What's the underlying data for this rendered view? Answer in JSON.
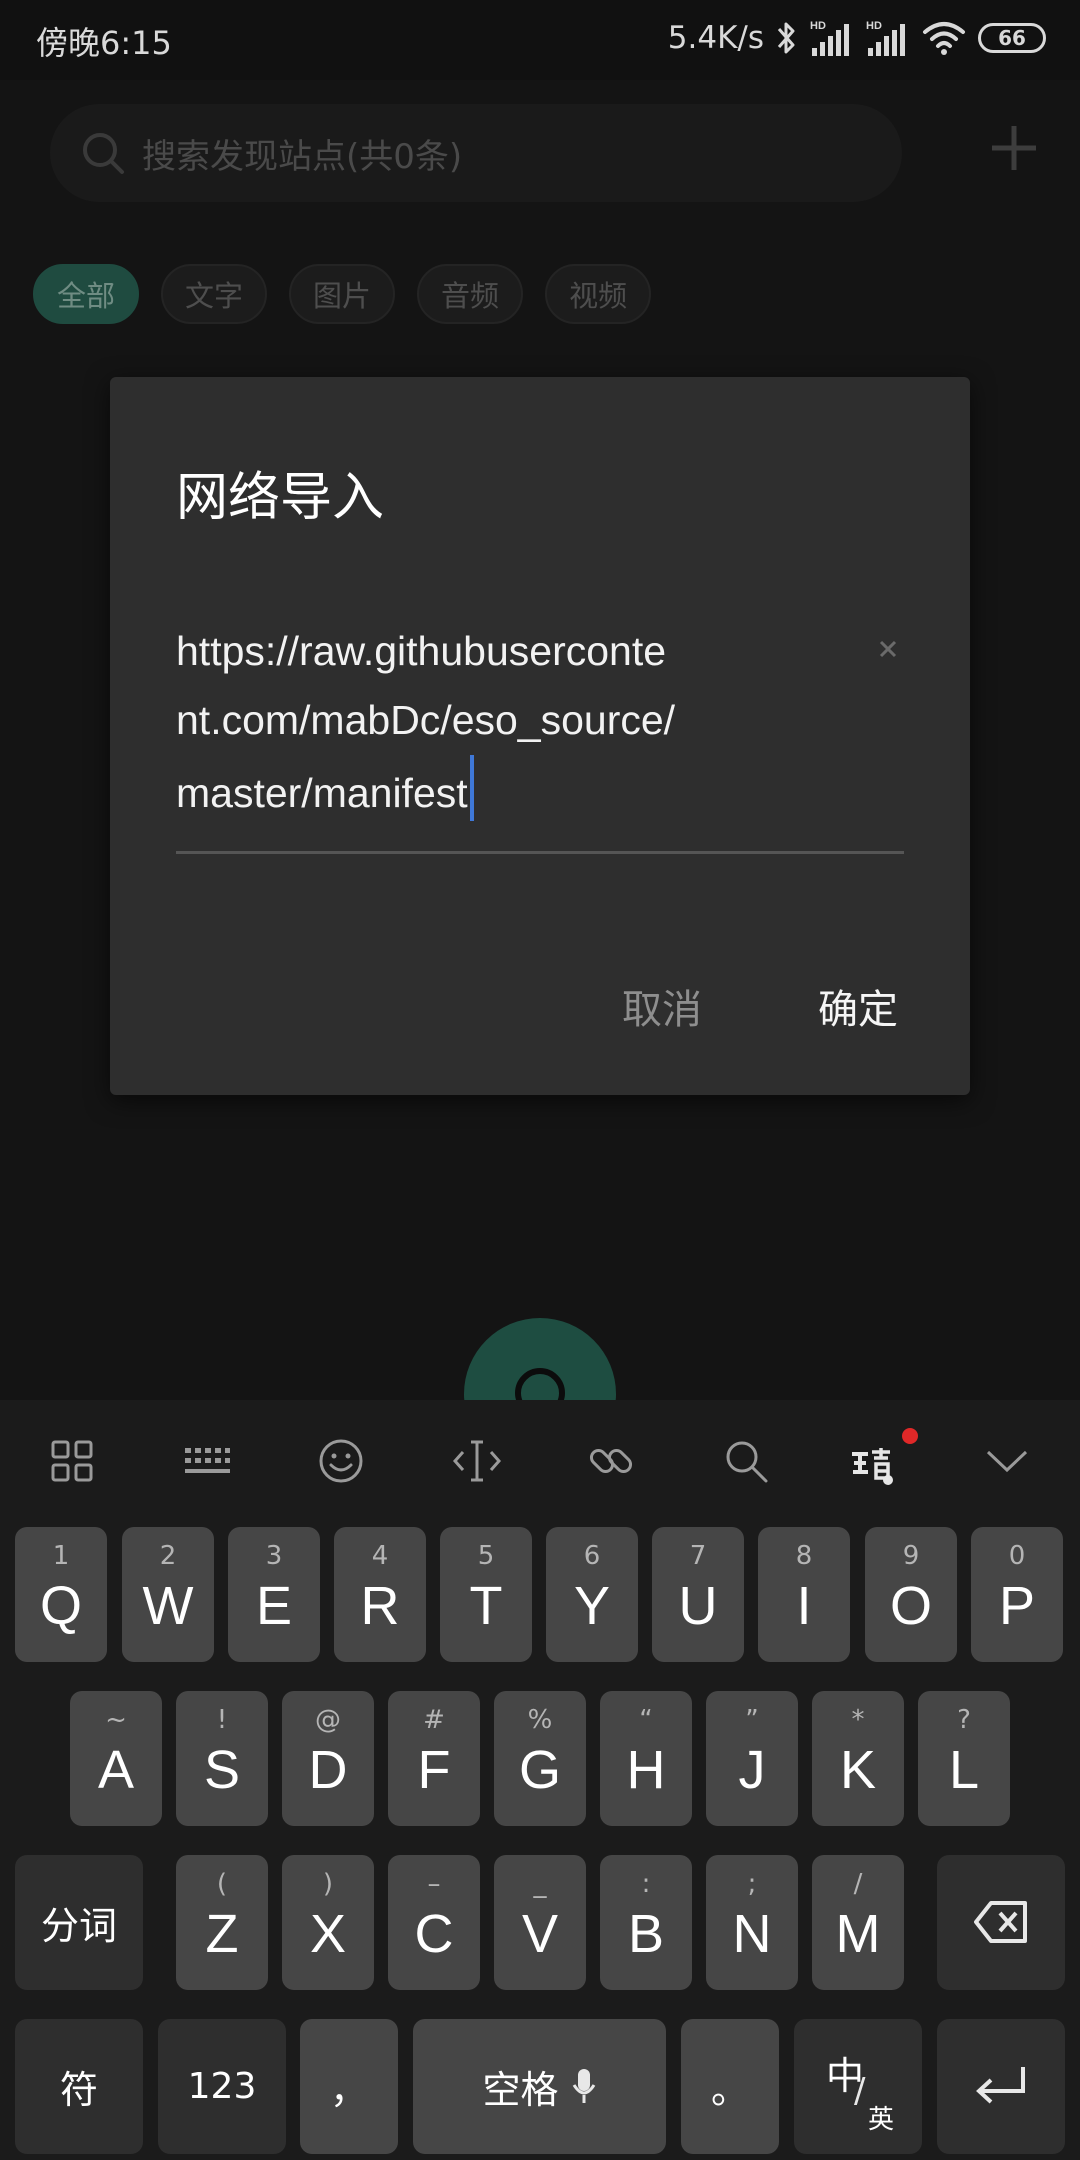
{
  "status_bar": {
    "time": "傍晚6:15",
    "net_speed": "5.4K/s",
    "network_badge_1": "HD",
    "network_badge_2": "HD",
    "battery": "66"
  },
  "background_app": {
    "search_placeholder": "搜索发现站点(共0条)",
    "chips": [
      "全部",
      "文字",
      "图片",
      "音频",
      "视频"
    ],
    "active_chip": "全部",
    "accent_color": "#1f4b40"
  },
  "dialog": {
    "title": "网络导入",
    "url_value": "https://raw.githubusercontent.com/mabDc/eso_source/master/manifest",
    "cancel_label": "取消",
    "confirm_label": "确定"
  },
  "keyboard": {
    "toolbar_icons": [
      "apps-grid-icon",
      "keyboard-icon",
      "emoji-icon",
      "cursor-move-icon",
      "link-icon",
      "search-icon",
      "brand-logo-icon",
      "collapse-chevron-icon"
    ],
    "row1": [
      {
        "main": "Q",
        "sub": "1"
      },
      {
        "main": "W",
        "sub": "2"
      },
      {
        "main": "E",
        "sub": "3"
      },
      {
        "main": "R",
        "sub": "4"
      },
      {
        "main": "T",
        "sub": "5"
      },
      {
        "main": "Y",
        "sub": "6"
      },
      {
        "main": "U",
        "sub": "7"
      },
      {
        "main": "I",
        "sub": "8"
      },
      {
        "main": "O",
        "sub": "9"
      },
      {
        "main": "P",
        "sub": "0"
      }
    ],
    "row2": [
      {
        "main": "A",
        "sub": "~"
      },
      {
        "main": "S",
        "sub": "!"
      },
      {
        "main": "D",
        "sub": "@"
      },
      {
        "main": "F",
        "sub": "#"
      },
      {
        "main": "G",
        "sub": "%"
      },
      {
        "main": "H",
        "sub": "“"
      },
      {
        "main": "J",
        "sub": "”"
      },
      {
        "main": "K",
        "sub": "*"
      },
      {
        "main": "L",
        "sub": "?"
      }
    ],
    "row3": [
      {
        "main": "Z",
        "sub": "("
      },
      {
        "main": "X",
        "sub": ")"
      },
      {
        "main": "C",
        "sub": "–"
      },
      {
        "main": "V",
        "sub": "_"
      },
      {
        "main": "B",
        "sub": ":"
      },
      {
        "main": "N",
        "sub": ";"
      },
      {
        "main": "M",
        "sub": "/"
      }
    ],
    "segment_label": "分词",
    "symbols_label": "符",
    "numbers_label": "123",
    "comma_label": "，",
    "space_label": "空格",
    "period_label": "。",
    "lang_main": "中",
    "lang_sub": "英"
  }
}
